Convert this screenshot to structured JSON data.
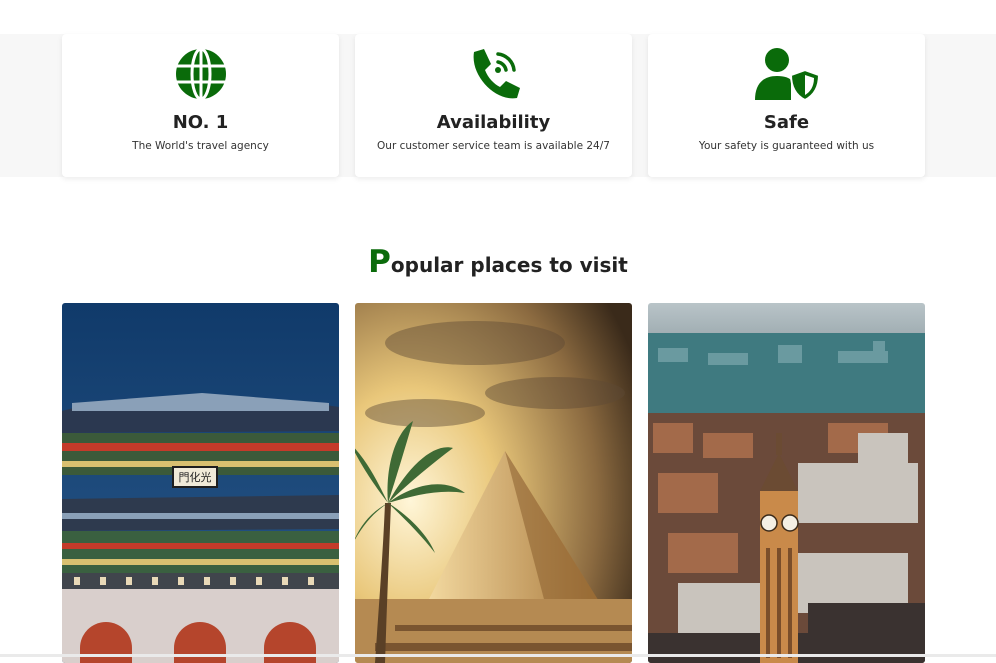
{
  "features": [
    {
      "icon": "globe-icon",
      "title": "NO. 1",
      "desc": "The World's travel agency"
    },
    {
      "icon": "phone-call-icon",
      "title": "Availability",
      "desc": "Our customer service team is available 24/7"
    },
    {
      "icon": "user-shield-icon",
      "title": "Safe",
      "desc": "Your safety is guaranteed with us"
    }
  ],
  "section": {
    "title_first": "P",
    "title_rest": "opular places to visit"
  },
  "places": [
    {
      "name": "Gwanghwamun gate, Seoul",
      "sign": "門化光"
    },
    {
      "name": "Pyramid of Giza, Egypt"
    },
    {
      "name": "Big Ben, London"
    }
  ],
  "colors": {
    "accent": "#0a6b0a",
    "band": "#f7f7f7"
  }
}
